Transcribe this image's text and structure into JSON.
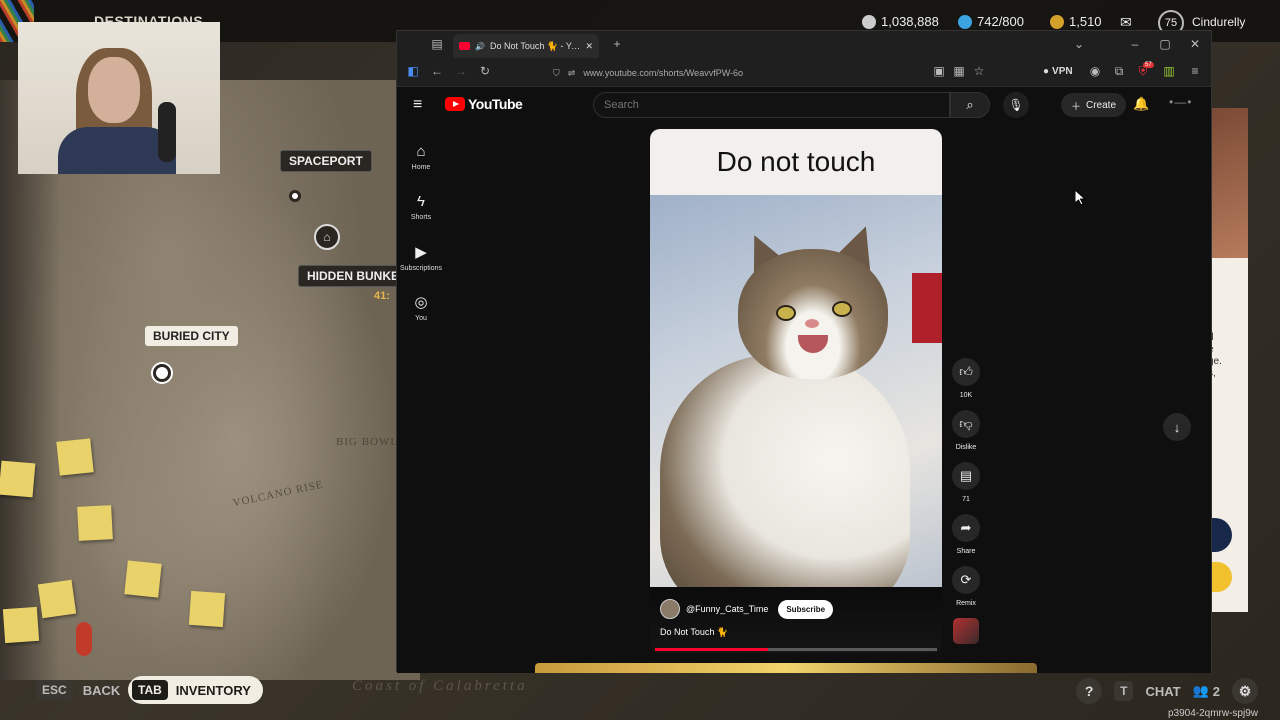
{
  "game": {
    "title": "DESTINATIONS",
    "stats": {
      "currency1": "1,038,888",
      "currency2": "742/800",
      "currency3": "1,510",
      "level": "75",
      "username": "Cindurelly"
    },
    "map": {
      "labels": {
        "spaceport": "SPACEPORT",
        "hidden_bunker": "HIDDEN BUNKE",
        "buried_city": "BURIED CITY",
        "big_bowl": "BIG BOWL",
        "volcano_rise": "VOLCANO RISE"
      },
      "timer": "41:",
      "coast_text": "Coast of Calabretta"
    },
    "bottom": {
      "esc_key": "ESC",
      "back_label": "BACK",
      "tab_key": "TAB",
      "inventory_label": "INVENTORY",
      "chat_key": "T",
      "chat_label": "CHAT",
      "party_count": "2",
      "session_id": "p3904-2qmrw-spj9w"
    },
    "right_card_text": "d\ne\nge.\ns,"
  },
  "browser": {
    "tab": {
      "title": "Do Not Touch 🐈 - YouTube"
    },
    "url": "www.youtube.com/shorts/WeavvfPW-6o",
    "vpn_label": "VPN",
    "ext_badge": "57"
  },
  "youtube": {
    "logo_text": "YouTube",
    "search_placeholder": "Search",
    "create_label": "Create",
    "guide": [
      {
        "label": "Home"
      },
      {
        "label": "Shorts"
      },
      {
        "label": "Subscriptions"
      },
      {
        "label": "You"
      }
    ],
    "short": {
      "overlay_title": "Do not touch",
      "channel": "@Funny_Cats_Time",
      "subscribe_label": "Subscribe",
      "caption": "Do Not Touch 🐈",
      "progress": 0.4
    },
    "actions": {
      "likes": "10K",
      "dislike_label": "Dislike",
      "comments": "71",
      "share_label": "Share",
      "remix_label": "Remix"
    }
  }
}
